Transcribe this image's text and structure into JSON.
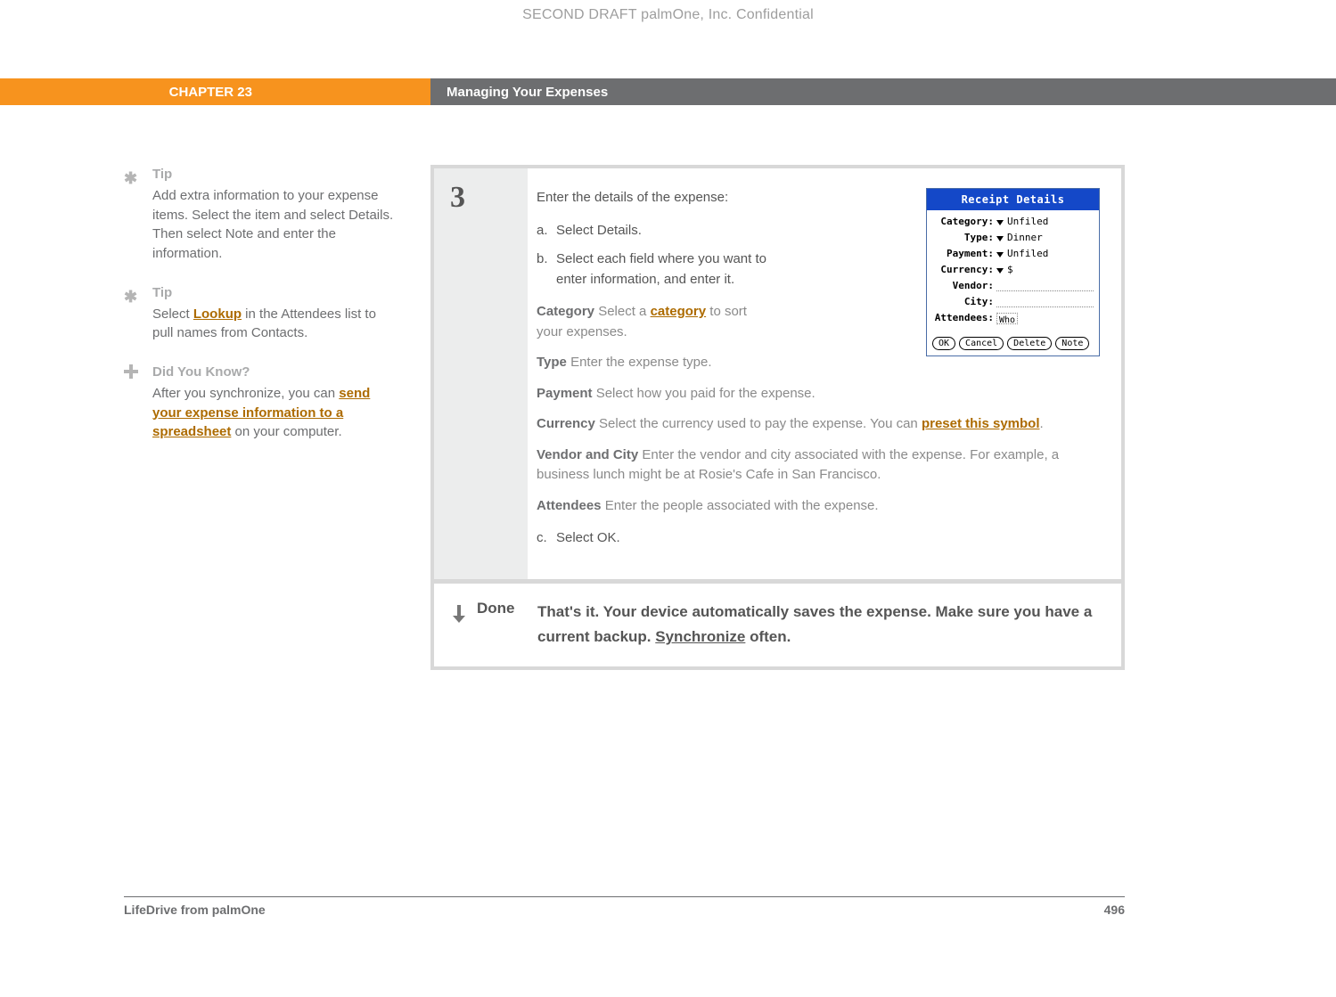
{
  "confidential": "SECOND DRAFT palmOne, Inc.  Confidential",
  "header": {
    "chapter": "CHAPTER 23",
    "title": "Managing Your Expenses"
  },
  "sidebar": {
    "tip1": {
      "title": "Tip",
      "body_a": "Add extra information to your expense items. Select the item and select Details. Then select Note and enter the information."
    },
    "tip2": {
      "title": "Tip",
      "body_pre": "Select ",
      "link": "Lookup",
      "body_post": " in the Attendees list to pull names from Contacts."
    },
    "dyk": {
      "title": "Did You Know?",
      "body_pre": "After you synchronize, you can ",
      "link": "send your expense information to a spreadsheet",
      "body_post": " on your computer."
    }
  },
  "step": {
    "number": "3",
    "intro": "Enter the details of the expense:",
    "a_letter": "a.",
    "a_text": "Select Details.",
    "b_letter": "b.",
    "b_text": "Select each field where you want to enter information, and enter it.",
    "c_letter": "c.",
    "c_text": "Select OK.",
    "fields": {
      "category": {
        "label": "Category",
        "desc_pre": "   Select a ",
        "link": "category",
        "desc_post": " to sort your expenses."
      },
      "type": {
        "label": "Type",
        "desc": "   Enter the expense type."
      },
      "payment": {
        "label": "Payment",
        "desc": "   Select how you paid for the expense."
      },
      "currency": {
        "label": "Currency",
        "desc_pre": "   Select the currency used to pay the expense. You can ",
        "link": "preset this symbol",
        "desc_post": "."
      },
      "vendor": {
        "label": "Vendor and City",
        "desc": "   Enter the vendor and city associated with the expense. For example, a business lunch might be at Rosie's Cafe in San Francisco."
      },
      "attendees": {
        "label": "Attendees",
        "desc": "   Enter the people associated with the expense."
      }
    }
  },
  "device": {
    "title": "Receipt Details",
    "rows": {
      "category": {
        "label": "Category:",
        "value": "Unfiled"
      },
      "type": {
        "label": "Type:",
        "value": "Dinner"
      },
      "payment": {
        "label": "Payment:",
        "value": "Unfiled"
      },
      "currency": {
        "label": "Currency:",
        "value": "$"
      },
      "vendor": {
        "label": "Vendor:"
      },
      "city": {
        "label": "City:"
      },
      "attendees": {
        "label": "Attendees:",
        "value": "Who"
      }
    },
    "buttons": {
      "ok": "OK",
      "cancel": "Cancel",
      "delete": "Delete",
      "note": "Note"
    }
  },
  "done": {
    "label": "Done",
    "text_pre": "That's it. Your device automatically saves the expense. Make sure you have a current backup. ",
    "link": "Synchronize",
    "text_post": " often."
  },
  "footer": {
    "left": "LifeDrive from palmOne",
    "right": "496"
  }
}
